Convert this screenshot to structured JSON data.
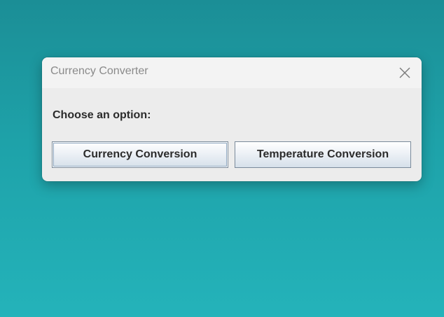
{
  "window": {
    "title": "Currency Converter",
    "close_icon": "close-icon"
  },
  "content": {
    "prompt": "Choose an option:",
    "buttons": [
      {
        "label": "Currency Conversion",
        "focused": true
      },
      {
        "label": "Temperature Conversion",
        "focused": false
      }
    ]
  },
  "colors": {
    "desktop_top": "#1b8e96",
    "desktop_bottom": "#24b3ba",
    "dialog_bg": "#ececec",
    "titlebar_bg": "#f3f3f3"
  }
}
